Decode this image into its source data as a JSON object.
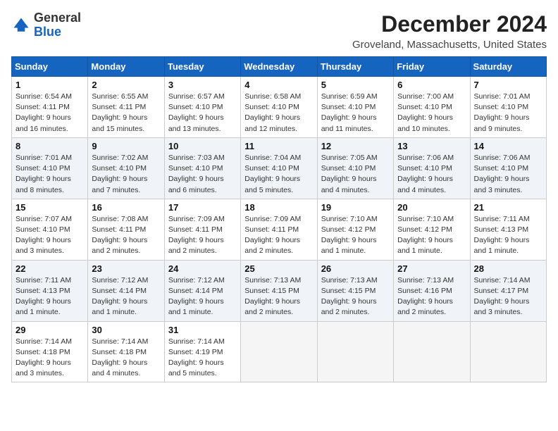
{
  "header": {
    "logo_general": "General",
    "logo_blue": "Blue",
    "month_title": "December 2024",
    "location": "Groveland, Massachusetts, United States"
  },
  "days_of_week": [
    "Sunday",
    "Monday",
    "Tuesday",
    "Wednesday",
    "Thursday",
    "Friday",
    "Saturday"
  ],
  "weeks": [
    [
      {
        "day": "1",
        "sunrise": "6:54 AM",
        "sunset": "4:11 PM",
        "daylight": "9 hours and 16 minutes."
      },
      {
        "day": "2",
        "sunrise": "6:55 AM",
        "sunset": "4:11 PM",
        "daylight": "9 hours and 15 minutes."
      },
      {
        "day": "3",
        "sunrise": "6:57 AM",
        "sunset": "4:10 PM",
        "daylight": "9 hours and 13 minutes."
      },
      {
        "day": "4",
        "sunrise": "6:58 AM",
        "sunset": "4:10 PM",
        "daylight": "9 hours and 12 minutes."
      },
      {
        "day": "5",
        "sunrise": "6:59 AM",
        "sunset": "4:10 PM",
        "daylight": "9 hours and 11 minutes."
      },
      {
        "day": "6",
        "sunrise": "7:00 AM",
        "sunset": "4:10 PM",
        "daylight": "9 hours and 10 minutes."
      },
      {
        "day": "7",
        "sunrise": "7:01 AM",
        "sunset": "4:10 PM",
        "daylight": "9 hours and 9 minutes."
      }
    ],
    [
      {
        "day": "8",
        "sunrise": "7:01 AM",
        "sunset": "4:10 PM",
        "daylight": "9 hours and 8 minutes."
      },
      {
        "day": "9",
        "sunrise": "7:02 AM",
        "sunset": "4:10 PM",
        "daylight": "9 hours and 7 minutes."
      },
      {
        "day": "10",
        "sunrise": "7:03 AM",
        "sunset": "4:10 PM",
        "daylight": "9 hours and 6 minutes."
      },
      {
        "day": "11",
        "sunrise": "7:04 AM",
        "sunset": "4:10 PM",
        "daylight": "9 hours and 5 minutes."
      },
      {
        "day": "12",
        "sunrise": "7:05 AM",
        "sunset": "4:10 PM",
        "daylight": "9 hours and 4 minutes."
      },
      {
        "day": "13",
        "sunrise": "7:06 AM",
        "sunset": "4:10 PM",
        "daylight": "9 hours and 4 minutes."
      },
      {
        "day": "14",
        "sunrise": "7:06 AM",
        "sunset": "4:10 PM",
        "daylight": "9 hours and 3 minutes."
      }
    ],
    [
      {
        "day": "15",
        "sunrise": "7:07 AM",
        "sunset": "4:10 PM",
        "daylight": "9 hours and 3 minutes."
      },
      {
        "day": "16",
        "sunrise": "7:08 AM",
        "sunset": "4:11 PM",
        "daylight": "9 hours and 2 minutes."
      },
      {
        "day": "17",
        "sunrise": "7:09 AM",
        "sunset": "4:11 PM",
        "daylight": "9 hours and 2 minutes."
      },
      {
        "day": "18",
        "sunrise": "7:09 AM",
        "sunset": "4:11 PM",
        "daylight": "9 hours and 2 minutes."
      },
      {
        "day": "19",
        "sunrise": "7:10 AM",
        "sunset": "4:12 PM",
        "daylight": "9 hours and 1 minute."
      },
      {
        "day": "20",
        "sunrise": "7:10 AM",
        "sunset": "4:12 PM",
        "daylight": "9 hours and 1 minute."
      },
      {
        "day": "21",
        "sunrise": "7:11 AM",
        "sunset": "4:13 PM",
        "daylight": "9 hours and 1 minute."
      }
    ],
    [
      {
        "day": "22",
        "sunrise": "7:11 AM",
        "sunset": "4:13 PM",
        "daylight": "9 hours and 1 minute."
      },
      {
        "day": "23",
        "sunrise": "7:12 AM",
        "sunset": "4:14 PM",
        "daylight": "9 hours and 1 minute."
      },
      {
        "day": "24",
        "sunrise": "7:12 AM",
        "sunset": "4:14 PM",
        "daylight": "9 hours and 1 minute."
      },
      {
        "day": "25",
        "sunrise": "7:13 AM",
        "sunset": "4:15 PM",
        "daylight": "9 hours and 2 minutes."
      },
      {
        "day": "26",
        "sunrise": "7:13 AM",
        "sunset": "4:15 PM",
        "daylight": "9 hours and 2 minutes."
      },
      {
        "day": "27",
        "sunrise": "7:13 AM",
        "sunset": "4:16 PM",
        "daylight": "9 hours and 2 minutes."
      },
      {
        "day": "28",
        "sunrise": "7:14 AM",
        "sunset": "4:17 PM",
        "daylight": "9 hours and 3 minutes."
      }
    ],
    [
      {
        "day": "29",
        "sunrise": "7:14 AM",
        "sunset": "4:18 PM",
        "daylight": "9 hours and 3 minutes."
      },
      {
        "day": "30",
        "sunrise": "7:14 AM",
        "sunset": "4:18 PM",
        "daylight": "9 hours and 4 minutes."
      },
      {
        "day": "31",
        "sunrise": "7:14 AM",
        "sunset": "4:19 PM",
        "daylight": "9 hours and 5 minutes."
      },
      null,
      null,
      null,
      null
    ]
  ],
  "labels": {
    "sunrise": "Sunrise:",
    "sunset": "Sunset:",
    "daylight": "Daylight:"
  }
}
